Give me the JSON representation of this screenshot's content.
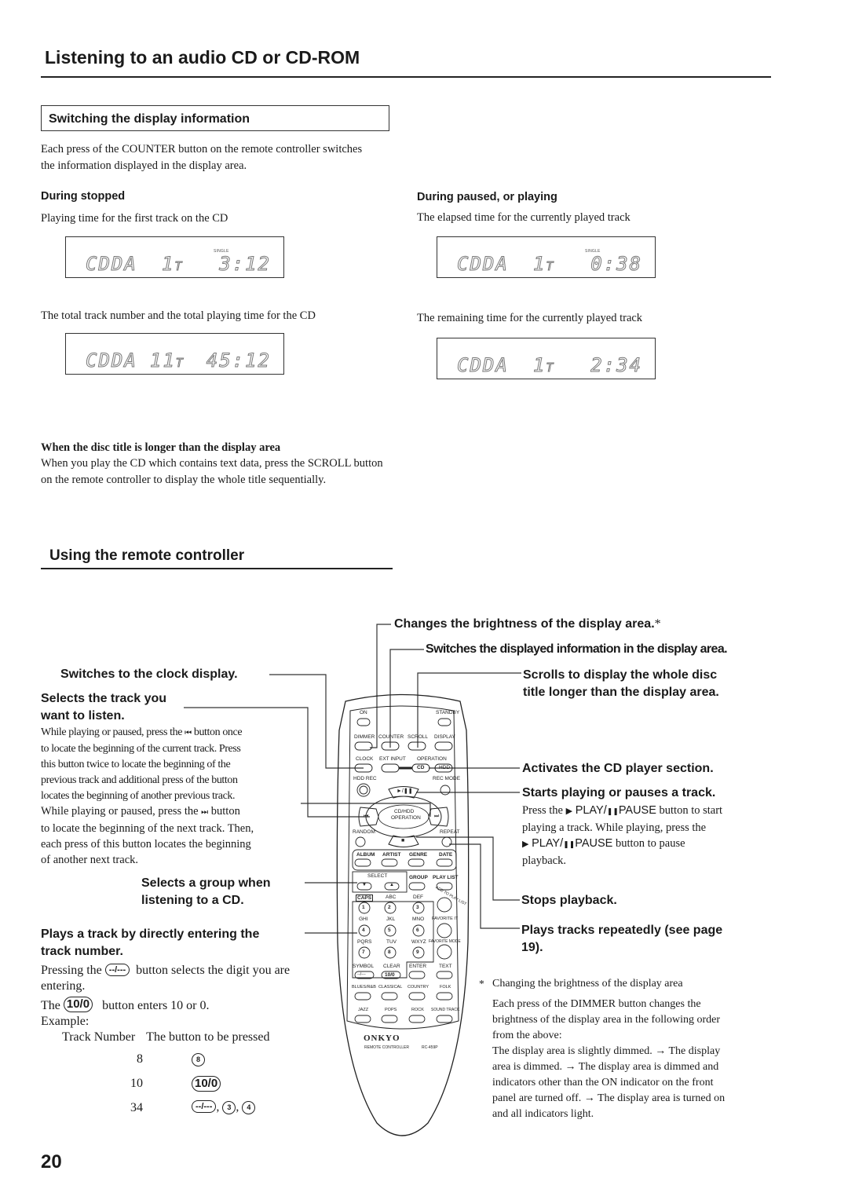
{
  "page": {
    "title": "Listening to an audio CD or CD-ROM",
    "page_number": "20"
  },
  "display_info": {
    "heading": "Switching the display information",
    "intro": "Each press of the COUNTER button on the remote controller switches the information displayed in the display area.",
    "stopped": {
      "heading": "During stopped",
      "first": {
        "caption": "Playing time for the first track on the CD",
        "indicator": "SINGLE",
        "mode": "CDDA",
        "track": "1",
        "track_suffix": "T",
        "time": "3:12"
      },
      "second": {
        "caption": "The total track number and the total playing time for the CD",
        "indicator": "",
        "mode": "CDDA",
        "track": "11",
        "track_suffix": "T",
        "time": "45:12"
      }
    },
    "playing": {
      "heading": "During paused, or playing",
      "first": {
        "caption": "The elapsed time for the currently played track",
        "indicator": "SINGLE",
        "mode": "CDDA",
        "track": "1",
        "track_suffix": "T",
        "time": "0:38"
      },
      "second": {
        "caption": "The remaining time for the currently played track",
        "indicator": "",
        "mode": "CDDA",
        "track": "1",
        "track_suffix": "T",
        "time": "2:34"
      }
    },
    "long_title": {
      "heading": "When the disc title is longer than the display area",
      "text": "When you play the CD which contains text data, press the SCROLL button on the remote controller to display the whole title sequentially."
    }
  },
  "remote_section": {
    "heading": "Using the remote controller",
    "callouts": {
      "dimmer": "Changes the brightness of the display area.",
      "dimmer_mark": "*",
      "counter": "Switches the displayed information in the display area.",
      "scroll_1": "Scrolls to display the whole disc",
      "scroll_2": "title longer than the display area.",
      "clock": "Switches to the clock display.",
      "select_track_1": "Selects the track you",
      "select_track_2": "want to listen.",
      "select_track_body": [
        "While playing or paused, press the",
        "button once",
        "to locate the beginning of the current track. Press",
        "this button twice to locate the beginning of the",
        "previous track and additional press of the button",
        "locates the beginning of another previous track."
      ],
      "next_track_body": [
        "While playing or paused, press the",
        "button",
        "to locate the beginning of the next track. Then,",
        "each press of this button locates the beginning",
        "of another next track."
      ],
      "cd_activate": "Activates the CD player section.",
      "play_pause_head": "Starts playing or pauses a track.",
      "play_pause_body": {
        "p1_a": "Press the",
        "play_label": "PLAY/",
        "pause_label": "PAUSE",
        "p1_b": "button to start",
        "p2": "playing a track. While playing, press the",
        "p3_b": "button to pause",
        "p4": "playback."
      },
      "group_1": "Selects a group when",
      "group_2": "listening to a CD.",
      "stop": "Stops playback.",
      "repeat_1": "Plays tracks repeatedly (see page",
      "repeat_2": "19).",
      "direct_1": "Plays a track by directly entering the",
      "direct_2": "track number."
    },
    "direct_entry": {
      "line1_a": "Pressing the",
      "digit_button": "--/---",
      "line1_b": "button selects the digit you are",
      "line2": "entering.",
      "line3_a": "The",
      "ten_button": "10/0",
      "line3_b": "button enters 10 or 0.",
      "example_label": "Example:",
      "col_track": "Track Number",
      "col_button": "The button to be pressed",
      "rows": [
        {
          "track": "8",
          "buttons": [
            "8"
          ]
        },
        {
          "track": "10",
          "buttons": [
            "10/0"
          ]
        },
        {
          "track": "34",
          "buttons": [
            "--/---",
            "3",
            "4"
          ]
        }
      ]
    },
    "footnote": {
      "mark": "*",
      "title": "Changing the brightness of the display area",
      "lines": [
        "Each press of the DIMMER button changes the",
        "brightness of the display area in the following order",
        "from the above:",
        "The display area is slightly dimmed. → The display",
        "area is dimmed. → The display area is dimmed and",
        "indicators other than the ON indicator on the front",
        "panel are turned off. → The display area is turned on",
        "and all indicators light."
      ]
    },
    "remote": {
      "brand": "ONKYO",
      "model_label": "REMOTE CONTROLLER",
      "model": "RC-459P",
      "labels": {
        "on": "ON",
        "standby": "STANDBY",
        "dimmer": "DIMMER",
        "counter": "COUNTER",
        "scroll": "SCROLL",
        "display": "DISPLAY",
        "clock": "CLOCK",
        "ext_input": "EXT INPUT",
        "operation": "OPERATION",
        "cd": "CD",
        "hdd": "HDD",
        "hdd_rec": "HDD REC",
        "rec_mode": "REC MODE",
        "cd_hdd_op_1": "CD/HDD",
        "cd_hdd_op_2": "OPERATION",
        "random": "RANDOM",
        "repeat": "REPEAT",
        "album": "ALBUM",
        "artist": "ARTIST",
        "genre": "GENRE",
        "date": "DATE",
        "select": "SELECT",
        "group": "GROUP",
        "play_list": "PLAY LIST",
        "caps": "CAPS",
        "abc": "ABC",
        "def": "DEF",
        "add_to_play_list": "ADD TO PLAY LIST",
        "ghi": "GHI",
        "jkl": "JKL",
        "mno": "MNO",
        "favorite_it": "FAVORITE IT",
        "pqrs": "PQRS",
        "tuv": "TUV",
        "wxyz": "WXYZ",
        "favorite_mode": "FAVORITE MODE",
        "symbol": "SYMBOL",
        "clear": "CLEAR",
        "enter": "ENTER",
        "text": "TEXT",
        "blues_rb": "BLUES/R&B",
        "classical": "CLASSICAL",
        "country": "COUNTRY",
        "folk": "FOLK",
        "jazz": "JAZZ",
        "pops": "POPS",
        "rock": "ROCK",
        "sound_track": "SOUND TRACK",
        "digits": [
          "1",
          "2",
          "3",
          "4",
          "5",
          "6",
          "7",
          "8",
          "9"
        ],
        "digit_toggle": "--/---",
        "ten": "10/0"
      }
    }
  }
}
